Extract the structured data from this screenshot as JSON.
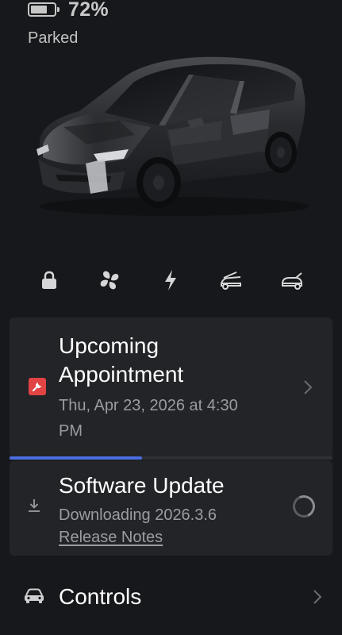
{
  "status": {
    "battery_percent_label": "72%",
    "battery_level": 0.72,
    "vehicle_state": "Parked"
  },
  "quick_controls": [
    {
      "name": "lock",
      "icon": "lock-icon"
    },
    {
      "name": "climate",
      "icon": "fan-icon"
    },
    {
      "name": "charge",
      "icon": "lightning-icon"
    },
    {
      "name": "frunk",
      "icon": "frunk-icon"
    },
    {
      "name": "trunk",
      "icon": "trunk-icon"
    }
  ],
  "appointment": {
    "title_line1": "Upcoming",
    "title_line2": "Appointment",
    "date_line1": "Thu, Apr 23, 2026 at 4:30",
    "date_line2": "PM",
    "icon": "wrench-icon",
    "progress": 0.41,
    "colors": {
      "badge": "#e24343",
      "progress": "#4a6ee0"
    }
  },
  "software_update": {
    "title": "Software Update",
    "status": "Downloading 2026.3.6",
    "release_notes": "Release Notes",
    "icon": "download-icon"
  },
  "controls": {
    "label": "Controls",
    "icon": "car-icon"
  }
}
